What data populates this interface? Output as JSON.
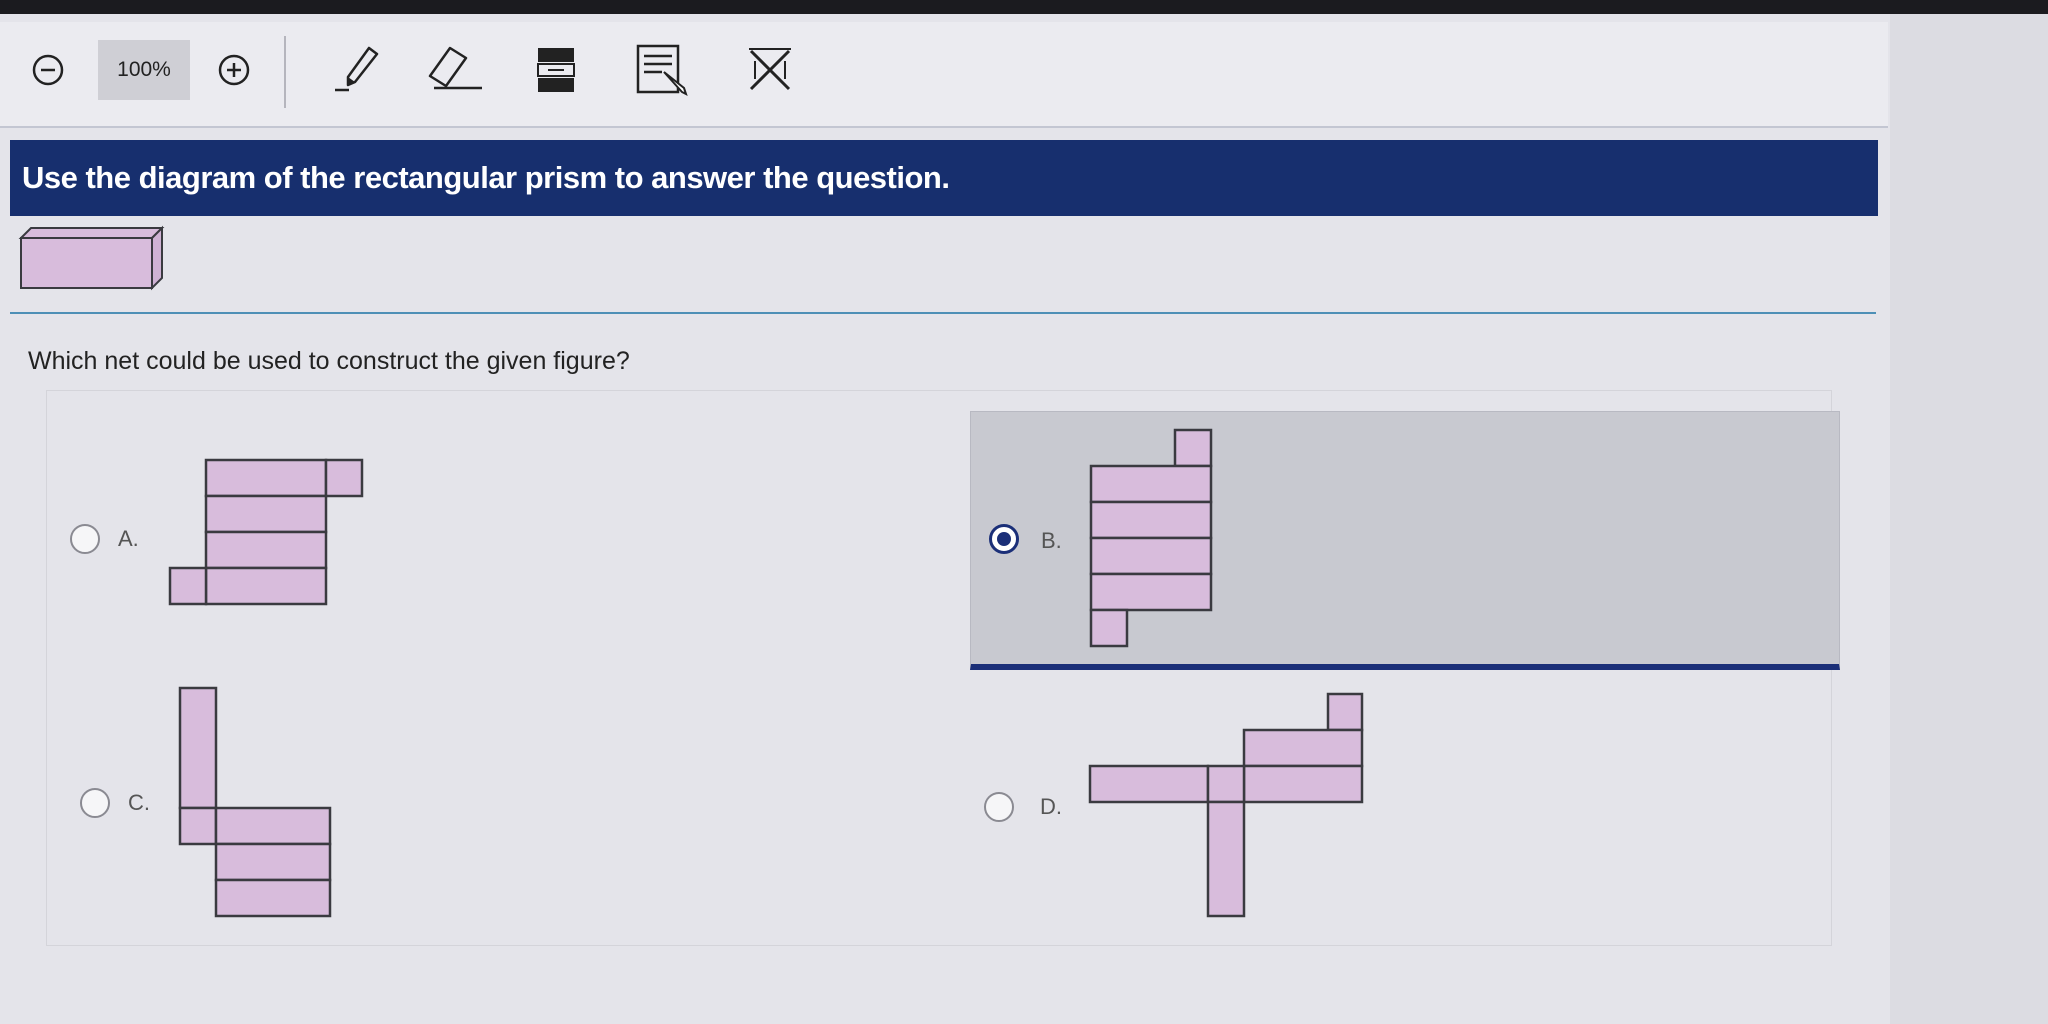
{
  "toolbar": {
    "zoom_level": "100%",
    "icons": [
      "zoom-out-icon",
      "zoom-in-icon",
      "highlighter-pen-icon",
      "eraser-icon",
      "line-reader-icon",
      "notepad-icon",
      "answer-eliminator-icon"
    ]
  },
  "question": {
    "header": "Use the diagram of the rectangular prism to answer the question.",
    "prompt": "Which net could be used to construct the given figure?"
  },
  "options": [
    {
      "label": "A.",
      "selected": false
    },
    {
      "label": "B.",
      "selected": true
    },
    {
      "label": "C.",
      "selected": false
    },
    {
      "label": "D.",
      "selected": false
    }
  ],
  "colors": {
    "header_bg": "#172f6e",
    "selected_accent": "#1b2f78",
    "net_fill": "#d8bcdc",
    "net_stroke": "#3a3a40",
    "divider": "#4d8fb6"
  }
}
